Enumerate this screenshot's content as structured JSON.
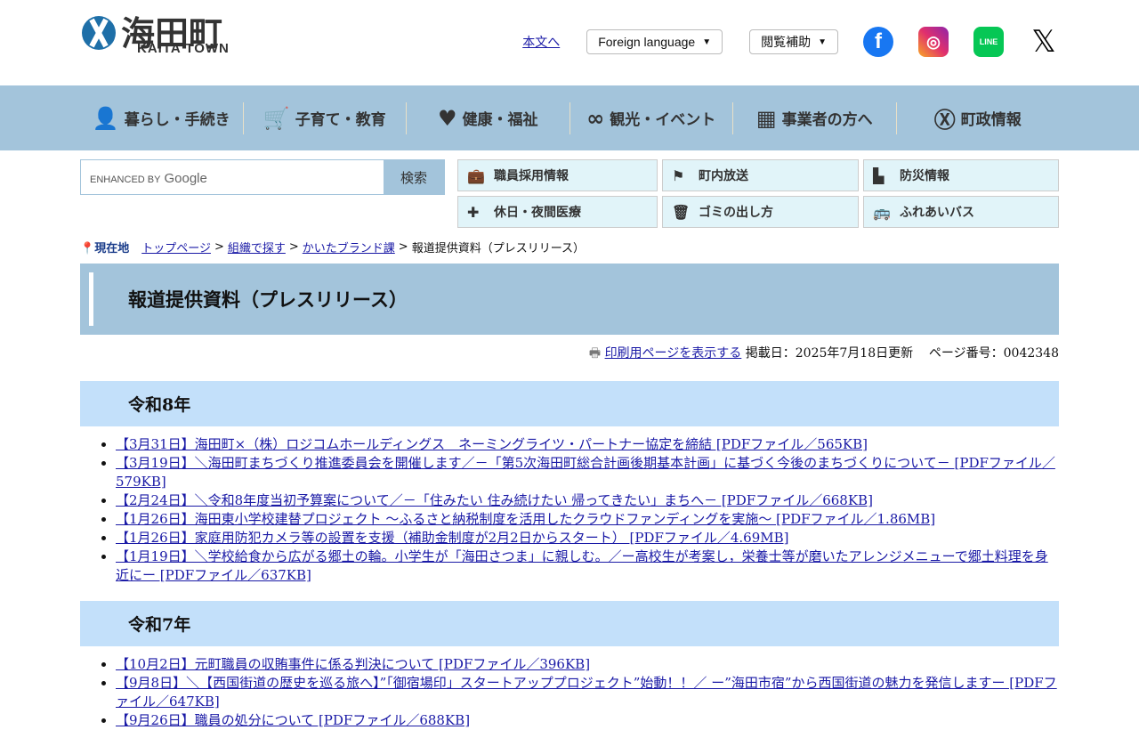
{
  "header": {
    "logo_text": "海田町",
    "logo_sub": "KAITA TOWN",
    "skip_link": "本文へ",
    "foreign_language": "Foreign language",
    "reading_aid": "閲覧補助",
    "sns": [
      {
        "name": "facebook",
        "color": "#1877f2"
      },
      {
        "name": "instagram",
        "color": "#e1306c"
      },
      {
        "name": "line",
        "color": "#06c755"
      },
      {
        "name": "x",
        "color": "#000000"
      }
    ]
  },
  "nav": [
    {
      "label": "暮らし・手続き",
      "icon": "person-icon"
    },
    {
      "label": "子育て・教育",
      "icon": "stroller-icon"
    },
    {
      "label": "健康・福祉",
      "icon": "heart-pulse-icon"
    },
    {
      "label": "観光・イベント",
      "icon": "binoculars-icon"
    },
    {
      "label": "事業者の方へ",
      "icon": "building-icon"
    },
    {
      "label": "町政情報",
      "icon": "town-emblem-icon"
    }
  ],
  "search": {
    "placeholder": "ENHANCED BY",
    "brand": "Google",
    "button": "検索"
  },
  "quick_links": [
    {
      "label": "職員採用情報",
      "icon": "briefcase-icon"
    },
    {
      "label": "町内放送",
      "icon": "speaker-icon"
    },
    {
      "label": "防災情報",
      "icon": "disaster-icon"
    },
    {
      "label": "休日・夜間医療",
      "icon": "medical-kit-icon"
    },
    {
      "label": "ゴミの出し方",
      "icon": "trash-icon"
    },
    {
      "label": "ふれあいバス",
      "icon": "bus-icon"
    }
  ],
  "breadcrumb": {
    "current_label": "現在地",
    "links": [
      "トップページ",
      "組織で探す",
      "かいたブランド課"
    ],
    "current": "報道提供資料（プレスリリース）"
  },
  "page_title": "報道提供資料（プレスリリース）",
  "meta": {
    "print": "印刷用ページを表示する",
    "updated": "掲載日：2025年7月18日更新",
    "page_no": "ページ番号：0042348"
  },
  "sections": [
    {
      "heading": "令和8年",
      "items": [
        "【3月31日】海田町×（株）ロジコムホールディングス　ネーミングライツ・パートナー協定を締結 [PDFファイル／565KB]",
        "【3月19日】＼海田町まちづくり推進委員会を開催します／－「第5次海田町総合計画後期基本計画」に基づく今後のまちづくりについて－ [PDFファイル／579KB]",
        "【2月24日】＼令和8年度当初予算案について／－「住みたい 住み続けたい 帰ってきたい」まちへ－ [PDFファイル／668KB]",
        "【1月26日】海田東小学校建替プロジェクト ～ふるさと納税制度を活用したクラウドファンディングを実施～ [PDFファイル／1.86MB]",
        "【1月26日】家庭用防犯カメラ等の設置を支援（補助金制度が2月2日からスタート） [PDFファイル／4.69MB]",
        "【1月19日】＼学校給食から広がる郷土の輪。小学生が「海田さつま」に親しむ。／ー高校生が考案し，栄養士等が磨いたアレンジメニューで郷土料理を身近にー [PDFファイル／637KB]"
      ]
    },
    {
      "heading": "令和7年",
      "items": [
        "【10月2日】元町職員の収賄事件に係る判決について [PDFファイル／396KB]",
        "【9月8日】＼【西国街道の歴史を巡る旅へ】”「御宿場印」スタートアッププロジェクト”始動！！／ ー”海田市宿”から西国街道の魅力を発信しますー [PDFファイル／647KB]",
        "【9月26日】職員の処分について [PDFファイル／688KB]"
      ]
    }
  ]
}
